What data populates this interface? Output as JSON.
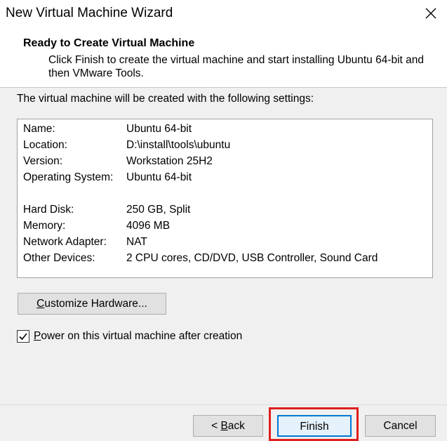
{
  "window": {
    "title": "New Virtual Machine Wizard",
    "close_icon": "close-icon"
  },
  "header": {
    "title": "Ready to Create Virtual Machine",
    "description": "Click Finish to create the virtual machine and start installing Ubuntu 64-bit and then VMware Tools."
  },
  "intro_text": "The virtual machine will be created with the following settings:",
  "summary": {
    "rows": [
      {
        "key": "Name:",
        "value": "Ubuntu 64-bit"
      },
      {
        "key": "Location:",
        "value": "D:\\install\\tools\\ubuntu"
      },
      {
        "key": "Version:",
        "value": "Workstation 25H2"
      },
      {
        "key": "Operating System:",
        "value": "Ubuntu 64-bit"
      },
      {
        "key": "Hard Disk:",
        "value": "250 GB, Split"
      },
      {
        "key": "Memory:",
        "value": "4096 MB"
      },
      {
        "key": "Network Adapter:",
        "value": "NAT"
      },
      {
        "key": "Other Devices:",
        "value": "2 CPU cores, CD/DVD, USB Controller, Sound Card"
      }
    ]
  },
  "buttons": {
    "customize_prefix": "C",
    "customize_rest": "ustomize Hardware...",
    "back_prefix": "< ",
    "back_mnemonic": "B",
    "back_rest": "ack",
    "finish": "Finish",
    "cancel": "Cancel"
  },
  "power_on": {
    "label_mnemonic": "P",
    "label_rest": "ower on this virtual machine after creation",
    "checked": true
  },
  "colors": {
    "highlight": "#e01e1e",
    "focus_border": "#0078d7",
    "checkbox_check": "#000000"
  }
}
